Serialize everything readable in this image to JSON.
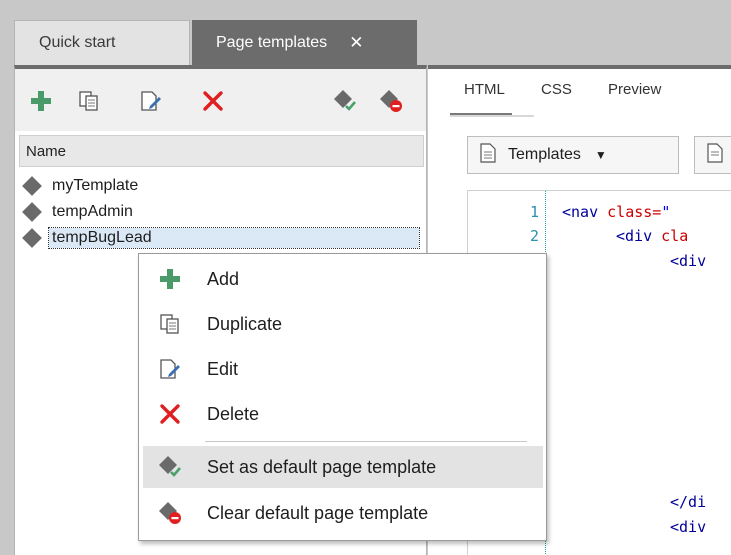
{
  "tabs": {
    "quick_start": "Quick start",
    "page_templates": "Page templates",
    "close_glyph": "✕"
  },
  "toolbar": {
    "icons": [
      "add-icon",
      "duplicate-icon",
      "edit-icon",
      "delete-icon",
      "set-default-icon",
      "clear-default-icon"
    ]
  },
  "list": {
    "column_header": "Name",
    "items": [
      {
        "label": "myTemplate",
        "selected": false
      },
      {
        "label": "tempAdmin",
        "selected": false
      },
      {
        "label": "tempBugLead",
        "selected": true
      }
    ]
  },
  "editor": {
    "tabs": [
      "HTML",
      "CSS",
      "Preview"
    ],
    "active_tab": "HTML",
    "templates_button": "Templates",
    "code_lines": [
      {
        "num": "1",
        "tag": "<nav ",
        "attr": "class=",
        "str": "\""
      },
      {
        "num": "2",
        "tag": "<div ",
        "attr": "cla",
        "str": ""
      },
      {
        "num": "",
        "tag": "<div",
        "attr": "",
        "str": ""
      },
      {
        "num": "",
        "tag": "</di",
        "attr": "",
        "str": ""
      },
      {
        "num": "",
        "tag": "<div",
        "attr": "",
        "str": ""
      }
    ]
  },
  "context_menu": {
    "items": [
      {
        "label": "Add",
        "icon": "add-icon"
      },
      {
        "label": "Duplicate",
        "icon": "duplicate-icon"
      },
      {
        "label": "Edit",
        "icon": "edit-icon"
      },
      {
        "label": "Delete",
        "icon": "delete-icon"
      },
      {
        "label": "Set as default page template",
        "icon": "set-default-icon",
        "hover": true
      },
      {
        "label": "Clear default page template",
        "icon": "clear-default-icon"
      }
    ]
  },
  "colors": {
    "add_green": "#4a9a6a",
    "delete_red": "#e02020",
    "active_tab_bg": "#6c6c6c",
    "selection_bg": "#dbe8f5",
    "line_number": "#2b91af"
  }
}
